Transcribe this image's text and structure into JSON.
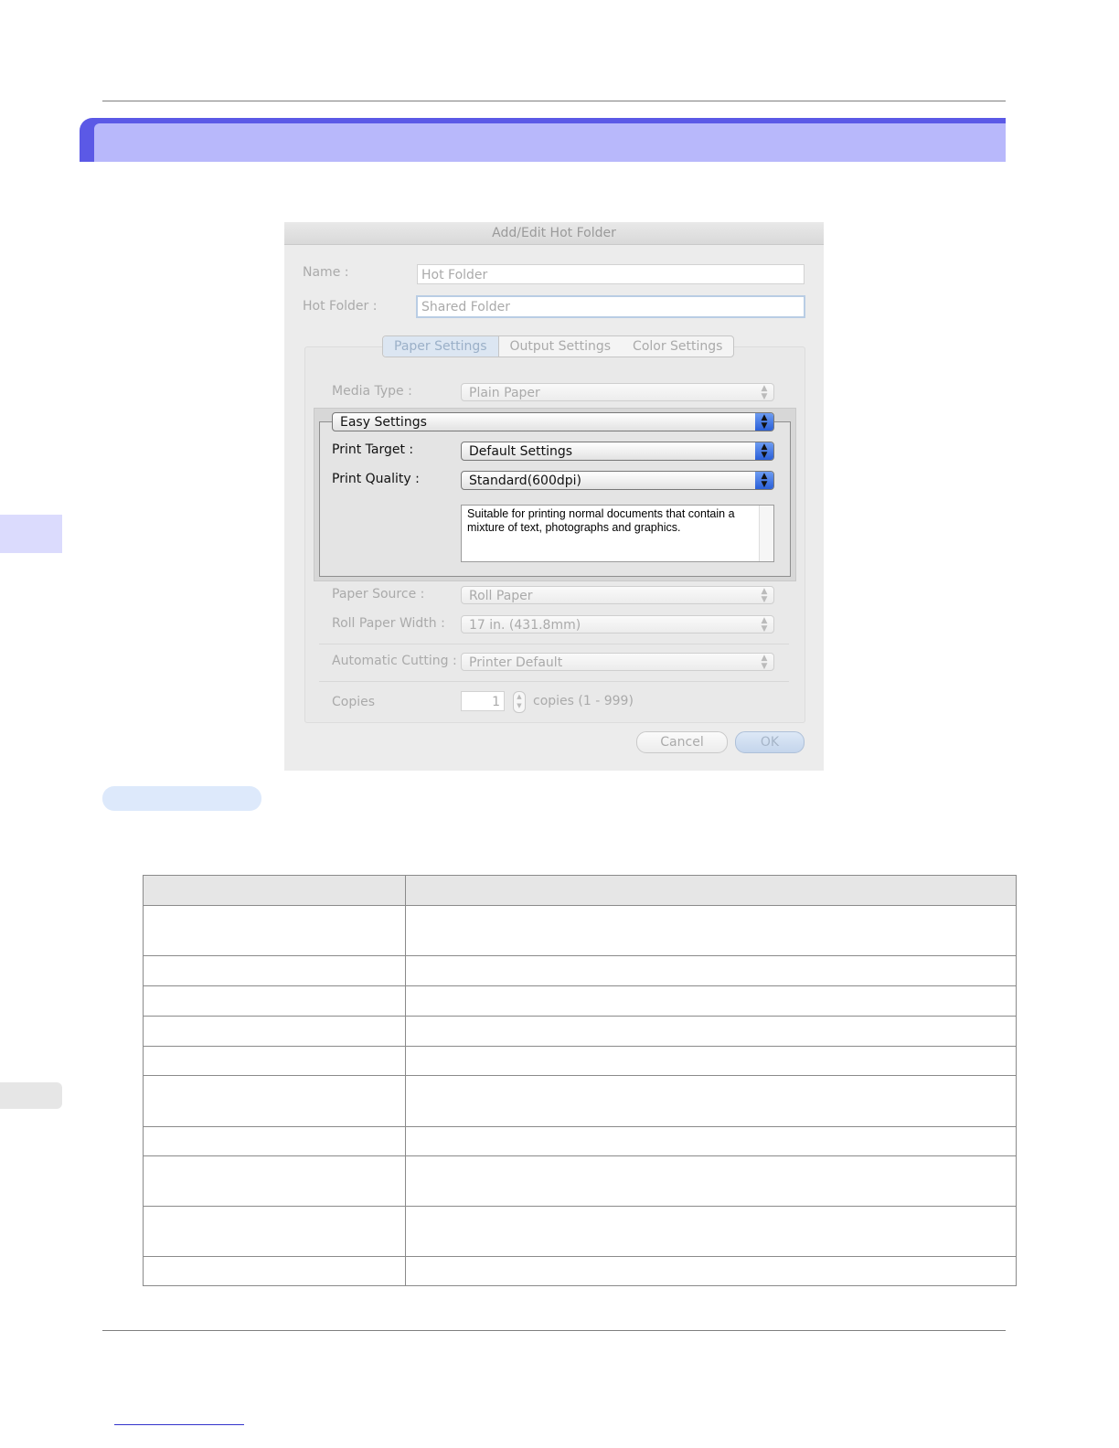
{
  "dialog": {
    "title": "Add/Edit Hot Folder",
    "name_label": "Name :",
    "name_value": "Hot Folder",
    "hotfolder_label": "Hot Folder :",
    "hotfolder_value": "Shared Folder",
    "tabs": [
      "Paper Settings",
      "Output Settings",
      "Color Settings"
    ],
    "media_type_label": "Media Type :",
    "media_type_value": "Plain Paper",
    "easy_settings": "Easy Settings",
    "print_target_label": "Print Target :",
    "print_target_value": "Default Settings",
    "print_quality_label": "Print Quality :",
    "print_quality_value": "Standard(600dpi)",
    "description": "Suitable for printing normal documents that contain a mixture of text, photographs and graphics.",
    "paper_source_label": "Paper Source :",
    "paper_source_value": "Roll Paper",
    "roll_width_label": "Roll Paper Width :",
    "roll_width_value": "17 in. (431.8mm)",
    "auto_cut_label": "Automatic Cutting :",
    "auto_cut_value": "Printer Default",
    "copies_label": "Copies",
    "copies_value": "1",
    "copies_range": "copies (1 - 999)",
    "cancel_label": "Cancel",
    "ok_label": "OK"
  },
  "colors": {
    "title_bar": "#5b59e6",
    "title_fill": "#b8b8fb",
    "side_tab": "#dbdbfd"
  }
}
